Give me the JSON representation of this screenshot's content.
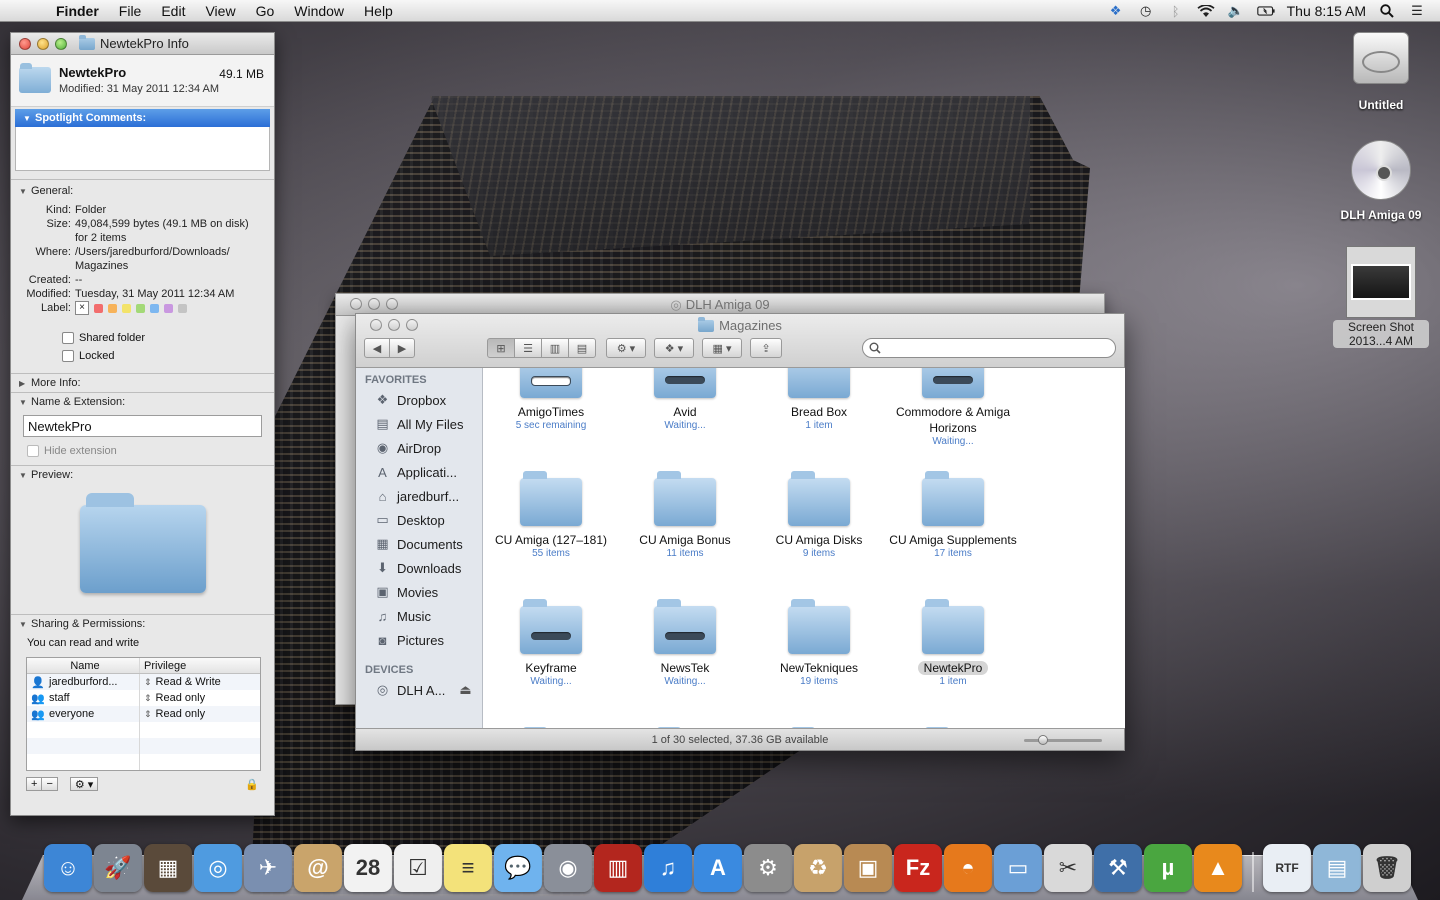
{
  "menubar": {
    "app": "Finder",
    "menus": [
      "File",
      "Edit",
      "View",
      "Go",
      "Window",
      "Help"
    ],
    "clock": "Thu 8:15 AM",
    "status_icons": [
      "dropbox-icon",
      "time-machine-icon",
      "bluetooth-icon",
      "wifi-icon",
      "volume-icon",
      "battery-icon"
    ]
  },
  "info": {
    "window_title": "NewtekPro Info",
    "name": "NewtekPro",
    "size": "49.1 MB",
    "modified_line": "Modified: 31 May 2011 12:34 AM",
    "spotlight_header": "Spotlight Comments:",
    "general_header": "General:",
    "general": {
      "kind_k": "Kind:",
      "kind_v": "Folder",
      "size_k": "Size:",
      "size_v": "49,084,599 bytes (49.1 MB on disk) for 2 items",
      "where_k": "Where:",
      "where_v": "/Users/jaredburford/Downloads/ Magazines",
      "created_k": "Created:",
      "created_v": "--",
      "modified_k": "Modified:",
      "modified_v": "Tuesday, 31 May 2011 12:34 AM",
      "label_k": "Label:",
      "label_x": "×"
    },
    "label_colors": [
      "#f26d6d",
      "#f7b35a",
      "#f3e36a",
      "#a3d977",
      "#7db7f0",
      "#c998e0",
      "#c4c4c4"
    ],
    "shared_folder": "Shared folder",
    "locked": "Locked",
    "more_info_header": "More Info:",
    "name_ext_header": "Name & Extension:",
    "name_field": "NewtekPro",
    "hide_extension": "Hide extension",
    "preview_header": "Preview:",
    "sharing_header": "Sharing & Permissions:",
    "sharing_note": "You can read and write",
    "perm_cols": [
      "Name",
      "Privilege"
    ],
    "permissions": [
      {
        "name": "jaredburford...",
        "privilege": "Read & Write"
      },
      {
        "name": "staff",
        "privilege": "Read only"
      },
      {
        "name": "everyone",
        "privilege": "Read only"
      }
    ],
    "add_label": "+",
    "remove_label": "−",
    "action_label": "⚙ ▾"
  },
  "back_window": {
    "title": "DLH Amiga 09"
  },
  "finder": {
    "title": "Magazines",
    "sidebar_favorites": "FAVORITES",
    "favorites": [
      {
        "label": "Dropbox",
        "icon": "dropbox-icon",
        "glyph": "❖"
      },
      {
        "label": "All My Files",
        "icon": "all-files-icon",
        "glyph": "▤"
      },
      {
        "label": "AirDrop",
        "icon": "airdrop-icon",
        "glyph": "◉"
      },
      {
        "label": "Applicati...",
        "icon": "applications-icon",
        "glyph": "A"
      },
      {
        "label": "jaredburf...",
        "icon": "home-icon",
        "glyph": "⌂"
      },
      {
        "label": "Desktop",
        "icon": "desktop-icon",
        "glyph": "▭"
      },
      {
        "label": "Documents",
        "icon": "documents-icon",
        "glyph": "▦"
      },
      {
        "label": "Downloads",
        "icon": "downloads-icon",
        "glyph": "⬇"
      },
      {
        "label": "Movies",
        "icon": "movies-icon",
        "glyph": "▣"
      },
      {
        "label": "Music",
        "icon": "music-icon",
        "glyph": "♫"
      },
      {
        "label": "Pictures",
        "icon": "pictures-icon",
        "glyph": "◙"
      }
    ],
    "sidebar_devices": "DEVICES",
    "devices": [
      {
        "label": "DLH A...",
        "icon": "disc-icon",
        "glyph": "◎",
        "eject": "⏏"
      }
    ],
    "items": [
      {
        "name": "AmigoTimes",
        "sub": "5 sec remaining",
        "kind": "prog"
      },
      {
        "name": "Avid",
        "sub": "Waiting...",
        "kind": "dl"
      },
      {
        "name": "Bread Box",
        "sub": "1 item",
        "kind": "plain"
      },
      {
        "name": "Commodore & Amiga Horizons",
        "sub": "Waiting...",
        "kind": "dl"
      },
      {
        "name": "CU Amiga (127–181)",
        "sub": "55 items",
        "kind": "plain"
      },
      {
        "name": "CU Amiga Bonus",
        "sub": "11 items",
        "kind": "plain"
      },
      {
        "name": "CU Amiga Disks",
        "sub": "9 items",
        "kind": "plain"
      },
      {
        "name": "CU Amiga Supplements",
        "sub": "17 items",
        "kind": "plain"
      },
      {
        "name": "Keyframe",
        "sub": "Waiting...",
        "kind": "dl"
      },
      {
        "name": "NewsTek",
        "sub": "Waiting...",
        "kind": "dl"
      },
      {
        "name": "NewTekniques",
        "sub": "19 items",
        "kind": "plain"
      },
      {
        "name": "NewtekPro",
        "sub": "1 item",
        "kind": "plain",
        "selected": true
      }
    ],
    "status": "1 of 30 selected, 37.36 GB available"
  },
  "desktop": {
    "items": [
      {
        "label": "Untitled",
        "icon": "hard-drive-icon"
      },
      {
        "label": "DLH Amiga 09",
        "icon": "dvd-icon"
      },
      {
        "label": "Screen Shot 2013...4 AM",
        "icon": "screenshot-file-icon"
      }
    ]
  },
  "dock": {
    "apps": [
      {
        "name": "finder-icon",
        "color": "#3d86d6",
        "glyph": "☺"
      },
      {
        "name": "launchpad-icon",
        "color": "#7d8591",
        "glyph": "🚀"
      },
      {
        "name": "photo-browser-icon",
        "color": "#5a4a3a",
        "glyph": "▦"
      },
      {
        "name": "safari-icon",
        "color": "#4f9be0",
        "glyph": "◎"
      },
      {
        "name": "mail-stamp-icon",
        "color": "#7a8fb0",
        "glyph": "✈"
      },
      {
        "name": "address-book-icon",
        "color": "#c9a46b",
        "glyph": "@"
      },
      {
        "name": "calendar-icon",
        "color": "#f2f2f2",
        "glyph": "28"
      },
      {
        "name": "reminders-icon",
        "color": "#efefef",
        "glyph": "☑"
      },
      {
        "name": "notes-icon",
        "color": "#f3e27a",
        "glyph": "≡"
      },
      {
        "name": "messages-icon",
        "color": "#6fb3ee",
        "glyph": "💬"
      },
      {
        "name": "facetime-icon",
        "color": "#8a8f99",
        "glyph": "◉"
      },
      {
        "name": "photo-booth-icon",
        "color": "#b3261e",
        "glyph": "▥"
      },
      {
        "name": "itunes-icon",
        "color": "#2f7fd9",
        "glyph": "♫"
      },
      {
        "name": "app-store-icon",
        "color": "#3a8ae0",
        "glyph": "A"
      },
      {
        "name": "system-preferences-icon",
        "color": "#8c8c8c",
        "glyph": "⚙"
      },
      {
        "name": "archive-utility-icon",
        "color": "#c7a26b",
        "glyph": "♻"
      },
      {
        "name": "compress-icon",
        "color": "#b88a53",
        "glyph": "▣"
      },
      {
        "name": "filezilla-icon",
        "color": "#c9261d",
        "glyph": "Fz"
      },
      {
        "name": "firefox-icon",
        "color": "#e6791c",
        "glyph": "◓"
      },
      {
        "name": "remote-desktop-icon",
        "color": "#6b9fd6",
        "glyph": "▭"
      },
      {
        "name": "disk-utility-icon",
        "color": "#d9d9d9",
        "glyph": "✂"
      },
      {
        "name": "automator-icon",
        "color": "#3f6fa8",
        "glyph": "⚒"
      },
      {
        "name": "utorrent-icon",
        "color": "#4aa640",
        "glyph": "µ"
      },
      {
        "name": "vlc-icon",
        "color": "#e8891c",
        "glyph": "▲"
      }
    ],
    "right": [
      {
        "name": "rtf-document-icon",
        "color": "#e9eef4",
        "glyph": "RTF"
      },
      {
        "name": "downloads-stack-icon",
        "color": "#8fb7d8",
        "glyph": "▤"
      },
      {
        "name": "trash-icon",
        "color": "#cfcfcf",
        "glyph": "🗑"
      }
    ]
  }
}
